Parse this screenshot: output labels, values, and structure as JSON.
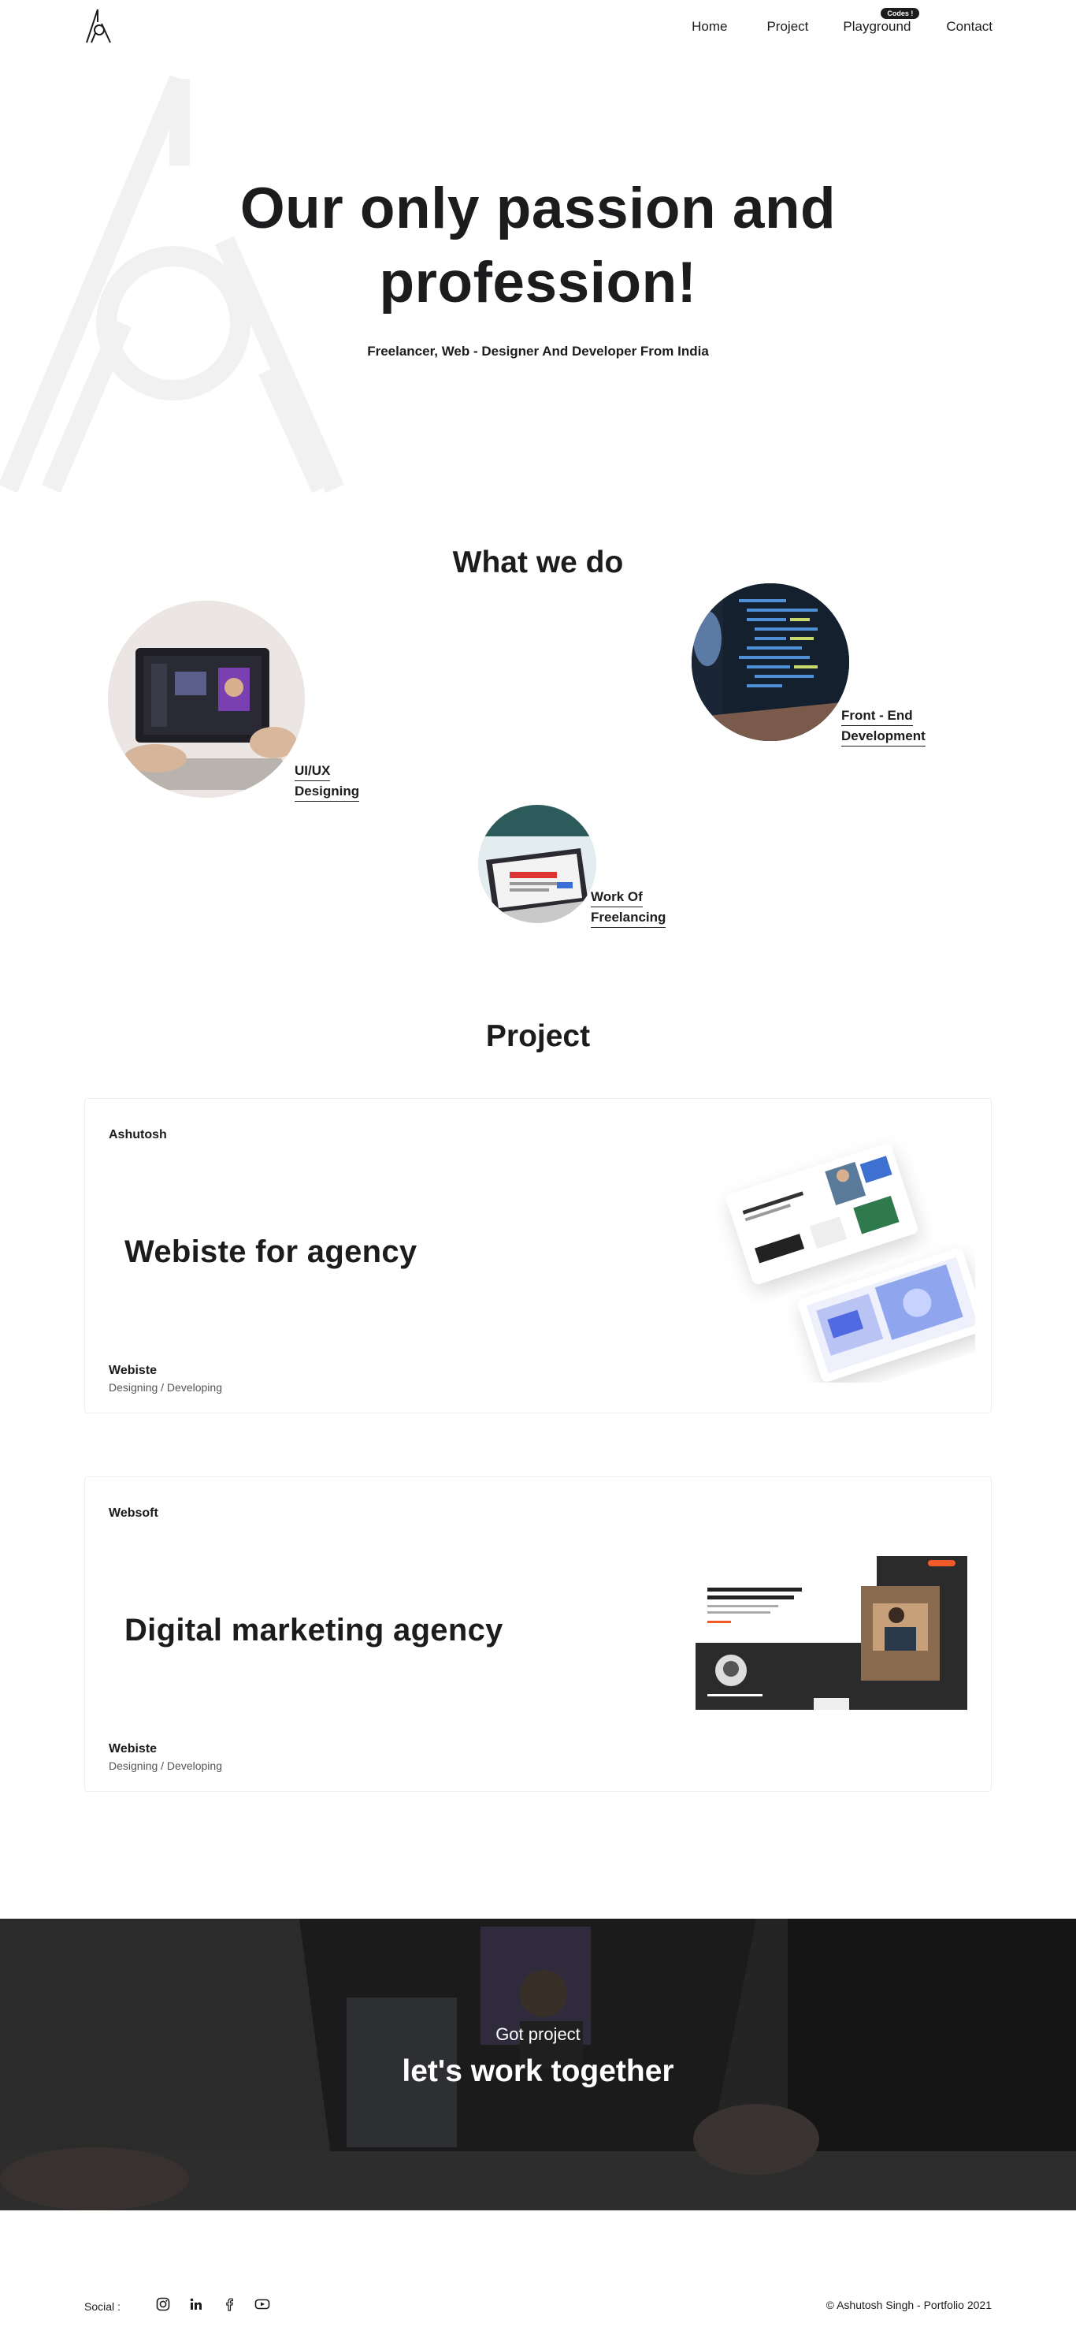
{
  "nav": {
    "items": [
      {
        "label": "Home"
      },
      {
        "label": "Project"
      },
      {
        "label": "Playground",
        "badge": "Codes !"
      },
      {
        "label": "Contact"
      }
    ]
  },
  "hero": {
    "title_line1": "Our only passion and",
    "title_line2": "profession!",
    "subtitle": "Freelancer, Web - Designer And Developer From India"
  },
  "services": {
    "heading": "What we do",
    "items": [
      {
        "line1": "UI/UX",
        "line2": "Designing",
        "image": "laptop-design-photo"
      },
      {
        "line1": "Front - End",
        "line2": "Development",
        "image": "code-screen-photo"
      },
      {
        "line1": "Work Of",
        "line2": "Freelancing",
        "image": "laptop-freelance-photo"
      }
    ]
  },
  "projects": {
    "heading": "Project",
    "cards": [
      {
        "client": "Ashutosh",
        "title": "Webiste for agency",
        "type": "Webiste",
        "sub": "Designing / Developing",
        "art": "agency-mockup-screens"
      },
      {
        "client": "Websoft",
        "title": "Digital marketing agency",
        "type": "Webiste",
        "sub": "Designing / Developing",
        "art": "marketing-site-screenshot"
      }
    ]
  },
  "cta": {
    "pre": "Got project",
    "main": "let's work together"
  },
  "footer": {
    "social_label": "Social :",
    "icons": [
      "instagram-icon",
      "linkedin-icon",
      "facebook-icon",
      "youtube-icon"
    ],
    "copyright": "© Ashutosh Singh - Portfolio 2021"
  },
  "colors": {
    "text": "#1c1c1e",
    "watermark": "#f1f1f1",
    "card_border": "#eeeeee",
    "cta_bg": "#2b2b2b"
  }
}
